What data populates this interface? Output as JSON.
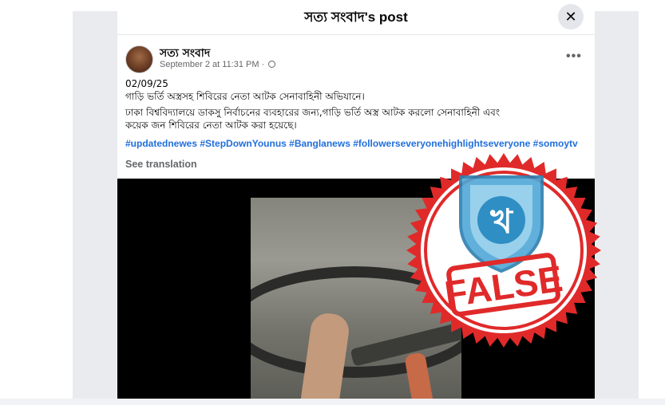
{
  "modal": {
    "title": "সত্য সংবাদ's post",
    "close_symbol": "✕"
  },
  "post": {
    "author": "সত্য সংবাদ",
    "timestamp": "September 2 at 11:31 PM",
    "meta_separator": "·",
    "more_symbol": "•••",
    "date_line": "02/09/25",
    "line1": "গাড়ি ভর্তি অস্ত্রসহ শিবিরের নেতা আটক সেনাবাহিনী অভিযানে।",
    "line2": "ঢাকা বিশ্ববিদ্যালয়ে ডাকসু নির্বাচনের ব্যবহারের জন্য,গাড়ি ভর্তি অস্ত্র আটক করলো সেনাবাহিনী এবং",
    "line3": "কয়েক জন শিবিরের নেতা আটক করা হয়েছে।",
    "hashtags": [
      "#updatednewes",
      "#StepDownYounus",
      "#Banglanews",
      "#followerseveryonehighlightseveryone",
      "#somoytv"
    ],
    "see_translation": "See translation"
  },
  "stamp": {
    "verdict": "FALSE",
    "logo_glyph": "খ",
    "colors": {
      "red": "#e02a2a",
      "shield": "#4fa8d8",
      "logo_bg": "#2f8fc4"
    }
  },
  "colors": {
    "link": "#216fdb",
    "muted": "#65676b",
    "text": "#050505"
  }
}
